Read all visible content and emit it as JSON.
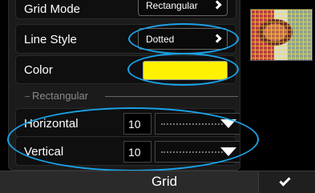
{
  "settings": {
    "grid_mode": {
      "label": "Grid Mode",
      "value": "Rectangular"
    },
    "line_style": {
      "label": "Line Style",
      "value": "Dotted"
    },
    "color": {
      "label": "Color",
      "swatch": "#fff200"
    }
  },
  "rectangular": {
    "section_label": "Rectangular",
    "horizontal": {
      "label": "Horizontal",
      "value": "10"
    },
    "vertical": {
      "label": "Vertical",
      "value": "10"
    }
  },
  "footer": {
    "title": "Grid",
    "confirm_icon": "checkmark-icon"
  },
  "preview": {
    "icon": "camera-preview-thumbnail"
  },
  "accent_colors": {
    "highlight_ellipse": "#1aa3e8",
    "grid_color": "#fff200"
  }
}
